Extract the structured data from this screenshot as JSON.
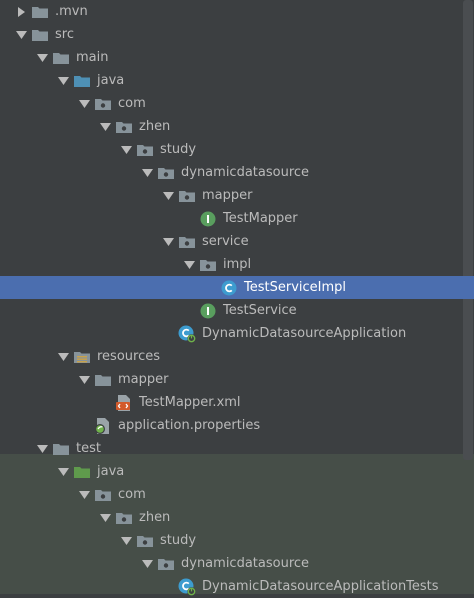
{
  "colors": {
    "background": "#3c3f41",
    "test_background": "#464e48",
    "selection": "#4b6eaf",
    "text": "#bbbbbb",
    "folder": "#87939a",
    "java_folder_main": "#4e90b5",
    "java_folder_test": "#5f9a4c",
    "interface_badge": "#599e5e",
    "class_badge": "#3d9ccf"
  },
  "tree": [
    {
      "label": ".mvn",
      "depth": 0,
      "arrow": "collapsed",
      "icon": "folder-icon"
    },
    {
      "label": "src",
      "depth": 0,
      "arrow": "expanded",
      "icon": "folder-icon"
    },
    {
      "label": "main",
      "depth": 1,
      "arrow": "expanded",
      "icon": "folder-icon"
    },
    {
      "label": "java",
      "depth": 2,
      "arrow": "expanded",
      "icon": "java-source-folder-icon"
    },
    {
      "label": "com",
      "depth": 3,
      "arrow": "expanded",
      "icon": "package-icon"
    },
    {
      "label": "zhen",
      "depth": 4,
      "arrow": "expanded",
      "icon": "package-icon"
    },
    {
      "label": "study",
      "depth": 5,
      "arrow": "expanded",
      "icon": "package-icon"
    },
    {
      "label": "dynamicdatasource",
      "depth": 6,
      "arrow": "expanded",
      "icon": "package-icon"
    },
    {
      "label": "mapper",
      "depth": 7,
      "arrow": "expanded",
      "icon": "package-icon"
    },
    {
      "label": "TestMapper",
      "depth": 8,
      "arrow": "none",
      "icon": "interface-icon"
    },
    {
      "label": "service",
      "depth": 7,
      "arrow": "expanded",
      "icon": "package-icon"
    },
    {
      "label": "impl",
      "depth": 8,
      "arrow": "expanded",
      "icon": "package-icon"
    },
    {
      "label": "TestServiceImpl",
      "depth": 9,
      "arrow": "none",
      "icon": "class-icon",
      "selected": true
    },
    {
      "label": "TestService",
      "depth": 8,
      "arrow": "none",
      "icon": "interface-icon"
    },
    {
      "label": "DynamicDatasourceApplication",
      "depth": 7,
      "arrow": "none",
      "icon": "spring-boot-class-icon"
    },
    {
      "label": "resources",
      "depth": 2,
      "arrow": "expanded",
      "icon": "resources-folder-icon"
    },
    {
      "label": "mapper",
      "depth": 3,
      "arrow": "expanded",
      "icon": "folder-icon"
    },
    {
      "label": "TestMapper.xml",
      "depth": 4,
      "arrow": "none",
      "icon": "xml-file-icon"
    },
    {
      "label": "application.properties",
      "depth": 3,
      "arrow": "none",
      "icon": "properties-file-icon"
    },
    {
      "label": "test",
      "depth": 1,
      "arrow": "expanded",
      "icon": "folder-icon"
    },
    {
      "label": "java",
      "depth": 2,
      "arrow": "expanded",
      "icon": "java-test-folder-icon"
    },
    {
      "label": "com",
      "depth": 3,
      "arrow": "expanded",
      "icon": "package-icon"
    },
    {
      "label": "zhen",
      "depth": 4,
      "arrow": "expanded",
      "icon": "package-icon"
    },
    {
      "label": "study",
      "depth": 5,
      "arrow": "expanded",
      "icon": "package-icon"
    },
    {
      "label": "dynamicdatasource",
      "depth": 6,
      "arrow": "expanded",
      "icon": "package-icon"
    },
    {
      "label": "DynamicDatasourceApplicationTests",
      "depth": 7,
      "arrow": "none",
      "icon": "spring-boot-test-class-icon"
    }
  ]
}
